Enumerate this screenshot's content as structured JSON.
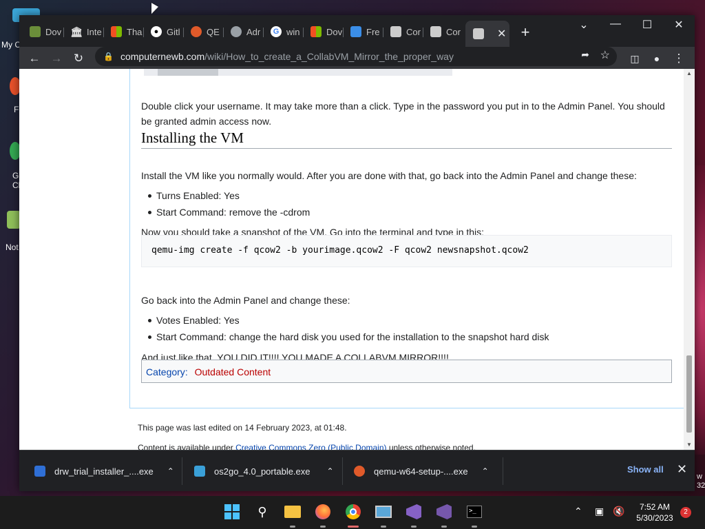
{
  "desktop": {
    "icons": [
      {
        "label": "My C",
        "color": "#3ba6d8"
      },
      {
        "label": "F",
        "color": "#e8512a"
      },
      {
        "label": "G\nCh",
        "color": "#34a853"
      },
      {
        "label": "Not",
        "color": "#8fbf5a"
      }
    ],
    "edge_text": [
      "w",
      "32"
    ]
  },
  "browser": {
    "tabs": [
      {
        "label": "Dov",
        "icon": "minecraft-icon",
        "color": "#6b8e3a"
      },
      {
        "label": "Inte",
        "icon": "archive-icon",
        "color": "#444"
      },
      {
        "label": "Tha",
        "icon": "windows-icon",
        "color": "#f25022"
      },
      {
        "label": "Gitl",
        "icon": "github-icon",
        "color": "#fff"
      },
      {
        "label": "QE",
        "icon": "qemu-icon",
        "color": "#e05a2a"
      },
      {
        "label": "Adr",
        "icon": "globe-icon",
        "color": "#9aa0a6"
      },
      {
        "label": "win",
        "icon": "google-icon",
        "color": "#4285f4"
      },
      {
        "label": "Dov",
        "icon": "windows-icon",
        "color": "#f25022"
      },
      {
        "label": "Fre",
        "icon": "freeform-icon",
        "color": "#3b8ee8"
      },
      {
        "label": "Cor",
        "icon": "collabvm-icon",
        "color": "#ccc"
      },
      {
        "label": "Cor",
        "icon": "collabvm-icon",
        "color": "#ccc"
      }
    ],
    "active_tab_icon": "collabvm-icon",
    "url_host": "computernewb.com",
    "url_path": "/wiki/How_to_create_a_CollabVM_Mirror_the_proper_way"
  },
  "article": {
    "p1": "Double click your username. It may take more than a click. Type in the password you put in to the Admin Panel. You should be granted admin access now.",
    "heading": "Installing the VM",
    "p2": "Install the VM like you normally would. After you are done with that, go back into the Admin Panel and change these:",
    "list1": [
      "Turns Enabled: Yes",
      "Start Command: remove the -cdrom"
    ],
    "p3": "Now you should take a snapshot of the VM. Go into the terminal and type in this:",
    "code": "qemu-img create -f qcow2 -b yourimage.qcow2 -F qcow2 newsnapshot.qcow2",
    "p4": "Go back into the Admin Panel and change these:",
    "list2": [
      "Votes Enabled: Yes",
      "Start Command: change the hard disk you used for the installation to the snapshot hard disk"
    ],
    "p5": "And just like that, YOU DID IT!!!! YOU MADE A COLLABVM MIRROR!!!!",
    "category_label": "Category",
    "category_value": "Outdated Content"
  },
  "footer": {
    "last_edited": "This page was last edited on 14 February 2023, at 01:48.",
    "license_prefix": "Content is available under ",
    "license_link": "Creative Commons Zero (Public Domain)",
    "license_suffix": " unless otherwise noted."
  },
  "downloads": {
    "items": [
      {
        "name": "drw_trial_installer_....exe",
        "color": "#2f6fd6"
      },
      {
        "name": "os2go_4.0_portable.exe",
        "color": "#3aa0d8"
      },
      {
        "name": "qemu-w64-setup-....exe",
        "color": "#e05a2a"
      }
    ],
    "show_all": "Show all"
  },
  "taskbar": {
    "time": "7:52 AM",
    "date": "5/30/2023",
    "notification_count": "2"
  }
}
